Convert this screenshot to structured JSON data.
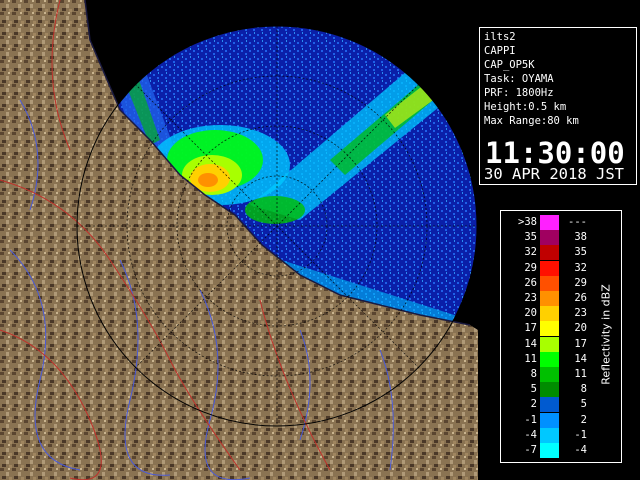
{
  "info": {
    "lines": [
      "ilts2",
      "CAPPI",
      "CAP_OP5K",
      "Task: OYAMA",
      "PRF: 1800Hz",
      "Height:0.5 km",
      "Max Range:80 km"
    ],
    "time": "11:30:00",
    "date": "30 APR 2018 JST"
  },
  "legend": {
    "title": "Reflectivity in dBZ",
    "rows": [
      {
        "lo": ">38",
        "hi": "---",
        "color": "#ff20ff"
      },
      {
        "lo": "35",
        "hi": "38",
        "color": "#a00060"
      },
      {
        "lo": "32",
        "hi": "35",
        "color": "#c00000"
      },
      {
        "lo": "29",
        "hi": "32",
        "color": "#ff1000"
      },
      {
        "lo": "26",
        "hi": "29",
        "color": "#ff5000"
      },
      {
        "lo": "23",
        "hi": "26",
        "color": "#ff9000"
      },
      {
        "lo": "20",
        "hi": "23",
        "color": "#ffd000"
      },
      {
        "lo": "17",
        "hi": "20",
        "color": "#ffff00"
      },
      {
        "lo": "14",
        "hi": "17",
        "color": "#a8ff00"
      },
      {
        "lo": "11",
        "hi": "14",
        "color": "#00ff00"
      },
      {
        "lo": "8",
        "hi": "11",
        "color": "#00c000"
      },
      {
        "lo": "5",
        "hi": "8",
        "color": "#008c00"
      },
      {
        "lo": "2",
        "hi": "5",
        "color": "#005ad0"
      },
      {
        "lo": "-1",
        "hi": "2",
        "color": "#0090ff"
      },
      {
        "lo": "-4",
        "hi": "-1",
        "color": "#00c8ff"
      },
      {
        "lo": "-7",
        "hi": "-4",
        "color": "#00ffff"
      }
    ]
  },
  "colors": {
    "sea": "#0a1fa8",
    "echo_weak": "#1f60e8",
    "land": "#8a7352",
    "coast": "#1a1a40",
    "rivers": "#4a5ad8",
    "boundaries": "#c0302a"
  }
}
